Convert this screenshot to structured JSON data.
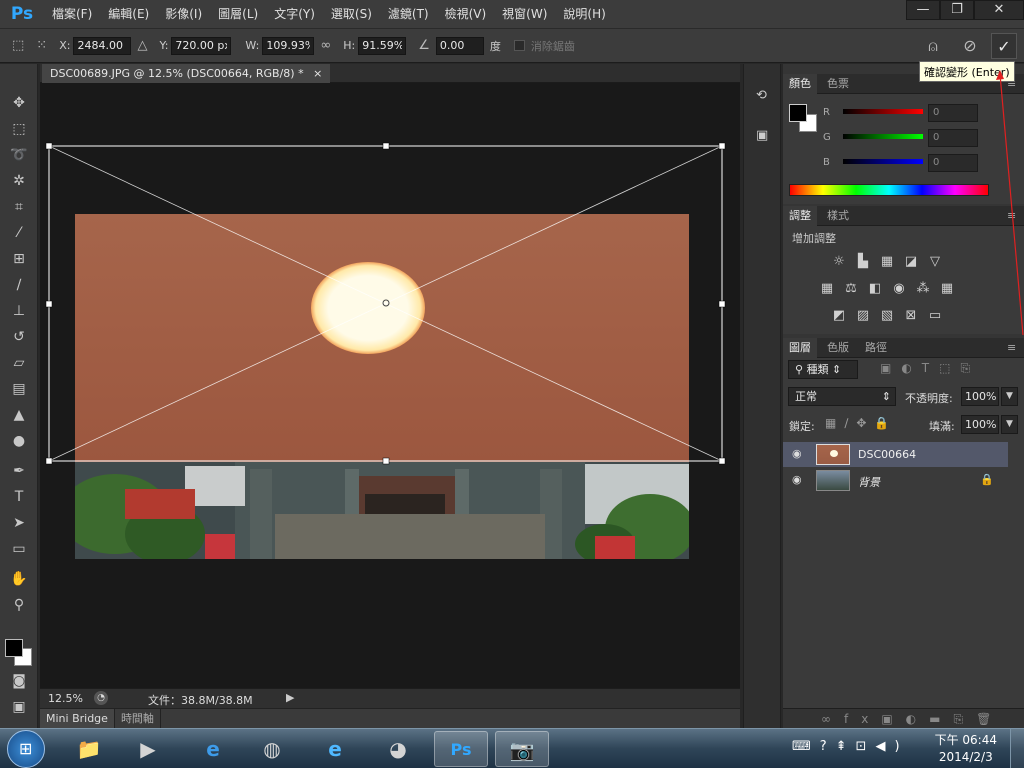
{
  "app": {
    "logo": "Ps",
    "menus": [
      "檔案(F)",
      "編輯(E)",
      "影像(I)",
      "圖層(L)",
      "文字(Y)",
      "選取(S)",
      "濾鏡(T)",
      "檢視(V)",
      "視窗(W)",
      "說明(H)"
    ]
  },
  "window_controls": {
    "minimize": "—",
    "restore": "❐",
    "close": "✕"
  },
  "options": {
    "x_label": "X:",
    "x_value": "2484.00 px",
    "y_label": "Y:",
    "y_value": "720.00 px",
    "w_label": "W:",
    "w_value": "109.93%",
    "h_label": "H:",
    "h_value": "91.59%",
    "angle_value": "0.00",
    "angle_unit": "度",
    "antialias_label": "消除鋸齒",
    "commit_tooltip": "確認變形 (Enter)"
  },
  "document": {
    "tab_title": "DSC00689.JPG @ 12.5% (DSC00664, RGB/8) *",
    "tab_close": "×",
    "zoom": "12.5%",
    "file_info": "文件：38.8M/38.8M"
  },
  "bottom_tabs": [
    "Mini Bridge",
    "時間軸"
  ],
  "color_panel": {
    "tabs": [
      "顏色",
      "色票"
    ],
    "channels": [
      {
        "label": "R",
        "value": "0"
      },
      {
        "label": "G",
        "value": "0"
      },
      {
        "label": "B",
        "value": "0"
      }
    ]
  },
  "adjust_panel": {
    "tabs": [
      "調整",
      "樣式"
    ],
    "heading": "增加調整"
  },
  "layers_panel": {
    "tabs": [
      "圖層",
      "色版",
      "路徑"
    ],
    "filter": "種類",
    "blend_mode": "正常",
    "opacity_label": "不透明度:",
    "opacity_value": "100%",
    "lock_label": "鎖定:",
    "fill_label": "填滿:",
    "fill_value": "100%",
    "layers": [
      {
        "name": "DSC00664",
        "selected": true,
        "locked": false
      },
      {
        "name": "背景",
        "selected": false,
        "locked": true
      }
    ]
  },
  "taskbar": {
    "time": "下午 06:44",
    "date": "2014/2/3"
  },
  "colors": {
    "accent": "#31a8ff",
    "sky": "#a7634a",
    "sun": "#fffbe8"
  }
}
